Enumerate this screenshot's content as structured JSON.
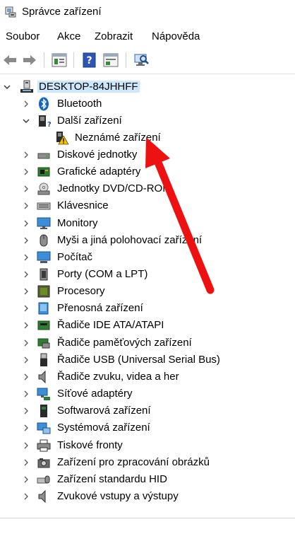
{
  "window": {
    "title": "Správce zařízení"
  },
  "menu": [
    "Soubor",
    "Akce",
    "Zobrazit",
    "Nápověda"
  ],
  "toolbar": {
    "buttons": [
      "back-icon",
      "forward-icon",
      "properties-icon",
      "help-icon",
      "update-driver-icon",
      "scan-hardware-icon"
    ]
  },
  "tree": {
    "root": "DESKTOP-84JHHFF",
    "items": [
      {
        "label": "Bluetooth",
        "icon": "bluetooth-icon",
        "expanded": false
      },
      {
        "label": "Další zařízení",
        "icon": "other-devices-icon",
        "expanded": true,
        "children": [
          {
            "label": "Neznámé zařízení",
            "icon": "unknown-device-warning-icon"
          }
        ]
      },
      {
        "label": "Diskové jednotky",
        "icon": "disk-drive-icon",
        "expanded": false
      },
      {
        "label": "Grafické adaptéry",
        "icon": "display-adapter-icon",
        "expanded": false
      },
      {
        "label": "Jednotky DVD/CD-ROM",
        "icon": "dvd-drive-icon",
        "expanded": false
      },
      {
        "label": "Klávesnice",
        "icon": "keyboard-icon",
        "expanded": false
      },
      {
        "label": "Monitory",
        "icon": "monitor-icon",
        "expanded": false
      },
      {
        "label": "Myši a jiná polohovací zařízení",
        "icon": "mouse-icon",
        "expanded": false
      },
      {
        "label": "Počítač",
        "icon": "computer-icon",
        "expanded": false
      },
      {
        "label": "Porty (COM a LPT)",
        "icon": "port-icon",
        "expanded": false
      },
      {
        "label": "Procesory",
        "icon": "processor-icon",
        "expanded": false
      },
      {
        "label": "Přenosná zařízení",
        "icon": "portable-device-icon",
        "expanded": false
      },
      {
        "label": "Řadiče IDE ATA/ATAPI",
        "icon": "ide-controller-icon",
        "expanded": false
      },
      {
        "label": "Řadiče paměťových zařízení",
        "icon": "storage-controller-icon",
        "expanded": false
      },
      {
        "label": "Řadiče USB (Universal Serial Bus)",
        "icon": "usb-icon",
        "expanded": false
      },
      {
        "label": "Řadiče zvuku, videa a her",
        "icon": "sound-icon",
        "expanded": false
      },
      {
        "label": "Síťové adaptéry",
        "icon": "network-adapter-icon",
        "expanded": false
      },
      {
        "label": "Softwarová zařízení",
        "icon": "software-device-icon",
        "expanded": false
      },
      {
        "label": "Systémová zařízení",
        "icon": "system-device-icon",
        "expanded": false
      },
      {
        "label": "Tiskové fronty",
        "icon": "printer-icon",
        "expanded": false
      },
      {
        "label": "Zařízení pro zpracování obrázků",
        "icon": "imaging-device-icon",
        "expanded": false
      },
      {
        "label": "Zařízení standardu HID",
        "icon": "hid-icon",
        "expanded": false
      },
      {
        "label": "Zvukové vstupy a výstupy",
        "icon": "audio-io-icon",
        "expanded": false
      }
    ]
  },
  "colors": {
    "selection": "#cce8ff",
    "annotation_arrow": "#ee1111",
    "warning": "#f2c200"
  }
}
